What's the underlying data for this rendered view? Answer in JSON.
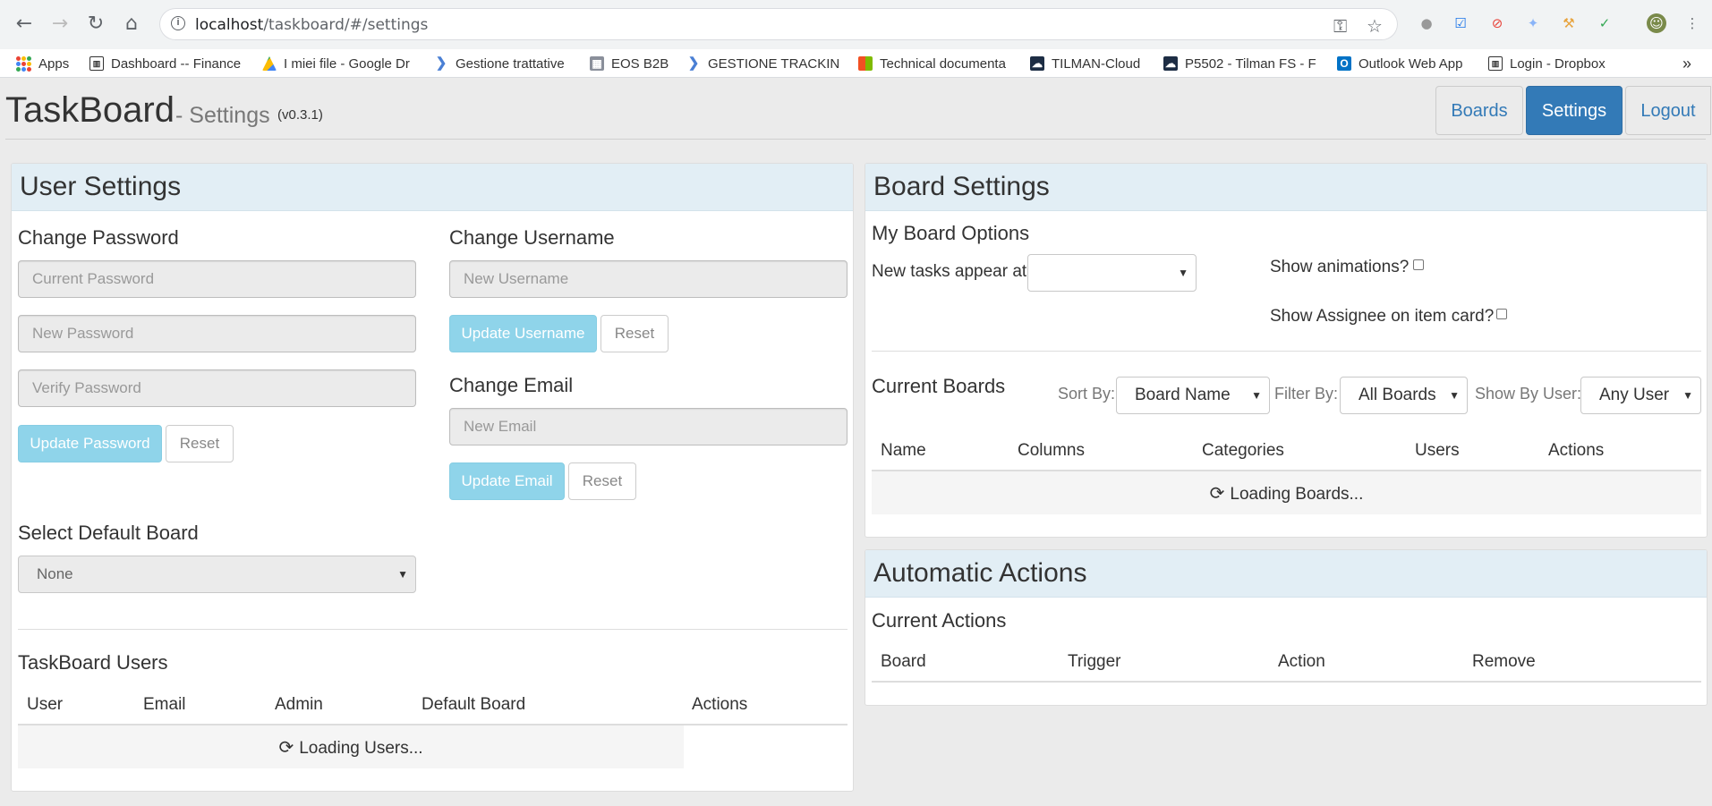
{
  "browser": {
    "url_host": "localhost",
    "url_path": "/taskboard/#/settings",
    "bookmarks": [
      {
        "label": "Apps"
      },
      {
        "label": "Dashboard -- Finance"
      },
      {
        "label": "I miei file - Google Dr"
      },
      {
        "label": "Gestione trattative"
      },
      {
        "label": "EOS B2B"
      },
      {
        "label": "GESTIONE TRACKING"
      },
      {
        "label": "Technical documenta"
      },
      {
        "label": "TILMAN-Cloud"
      },
      {
        "label": "P5502 - Tilman FS - F"
      },
      {
        "label": "Outlook Web App"
      },
      {
        "label": "Login - Dropbox"
      }
    ],
    "more_bookmarks": "»"
  },
  "header": {
    "brand": "TaskBoard",
    "subtitle": "- Settings",
    "version": "(v0.3.1)",
    "nav": {
      "boards": "Boards",
      "settings": "Settings",
      "logout": "Logout"
    }
  },
  "user_settings": {
    "title": "User Settings",
    "change_password": {
      "heading": "Change Password",
      "current_placeholder": "Current Password",
      "new_placeholder": "New Password",
      "verify_placeholder": "Verify Password",
      "update_label": "Update Password",
      "reset_label": "Reset"
    },
    "change_username": {
      "heading": "Change Username",
      "placeholder": "New Username",
      "update_label": "Update Username",
      "reset_label": "Reset"
    },
    "change_email": {
      "heading": "Change Email",
      "placeholder": "New Email",
      "update_label": "Update Email",
      "reset_label": "Reset"
    },
    "default_board": {
      "heading": "Select Default Board",
      "selected": "None"
    },
    "users": {
      "heading": "TaskBoard Users",
      "columns": [
        "User",
        "Email",
        "Admin",
        "Default Board",
        "Actions"
      ],
      "loading": "Loading Users..."
    }
  },
  "board_settings": {
    "title": "Board Settings",
    "options": {
      "heading": "My Board Options",
      "new_tasks_label": "New tasks appear at",
      "new_tasks_value": "",
      "show_animations": "Show animations?",
      "show_assignee": "Show Assignee on item card?"
    },
    "current_boards": {
      "heading": "Current Boards",
      "sort_label": "Sort By:",
      "sort_value": "Board Name",
      "filter_label": "Filter By:",
      "filter_value": "All Boards",
      "user_label": "Show By User:",
      "user_value": "Any User",
      "columns": [
        "Name",
        "Columns",
        "Categories",
        "Users",
        "Actions"
      ],
      "loading": "Loading Boards..."
    }
  },
  "automatic_actions": {
    "title": "Automatic Actions",
    "heading": "Current Actions",
    "columns": [
      "Board",
      "Trigger",
      "Action",
      "Remove"
    ]
  }
}
